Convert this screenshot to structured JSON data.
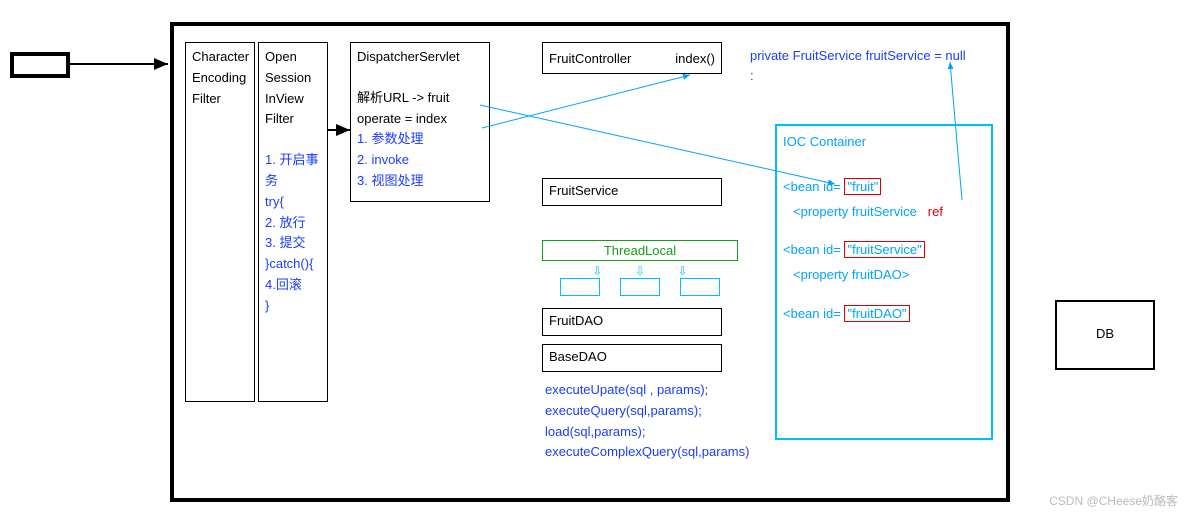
{
  "small_box": "",
  "main": {
    "filter1": {
      "l1": "Character",
      "l2": "Encoding",
      "l3": "Filter"
    },
    "filter2": {
      "l1": "Open",
      "l2": "Session",
      "l3": "InView",
      "l4": "Filter",
      "n1": "1. 开启事务",
      "n2": "try{",
      "n3": "2. 放行",
      "n4": "3. 提交",
      "n5": "}catch(){",
      "n6": "4.回滚",
      "n7": "}"
    },
    "dispatcher": {
      "title": "DispatcherServlet",
      "l2": "解析URL -> fruit",
      "l3": "operate = index",
      "s1": "1. 参数处理",
      "s2": "2. invoke",
      "s3": "3. 视图处理"
    },
    "fruitController": {
      "name": "FruitController",
      "method": "index()"
    },
    "fruitService": "FruitService",
    "threadLocal": "ThreadLocal",
    "fruitDAO": "FruitDAO",
    "baseDAO": "BaseDAO",
    "daoMethods": {
      "m1": "executeUpate(sql , params);",
      "m2": "executeQuery(sql,params);",
      "m3": "load(sql,params);",
      "m4": "executeComplexQuery(sql,params)"
    },
    "topRight": "private FruitService fruitService = null",
    "colon": ":",
    "ioc": {
      "title": "IOC Container",
      "b1a": "<bean id=",
      "b1v": "\"fruit\"",
      "p1a": "<property fruitService",
      "p1ref": "ref",
      "b2a": "<bean id=",
      "b2v": "\"fruitService\"",
      "p2": "<property fruitDAO>",
      "b3a": "<bean id=",
      "b3v": "\"fruitDAO\""
    }
  },
  "db": "DB",
  "watermark": "CSDN @CHeese奶酪客"
}
